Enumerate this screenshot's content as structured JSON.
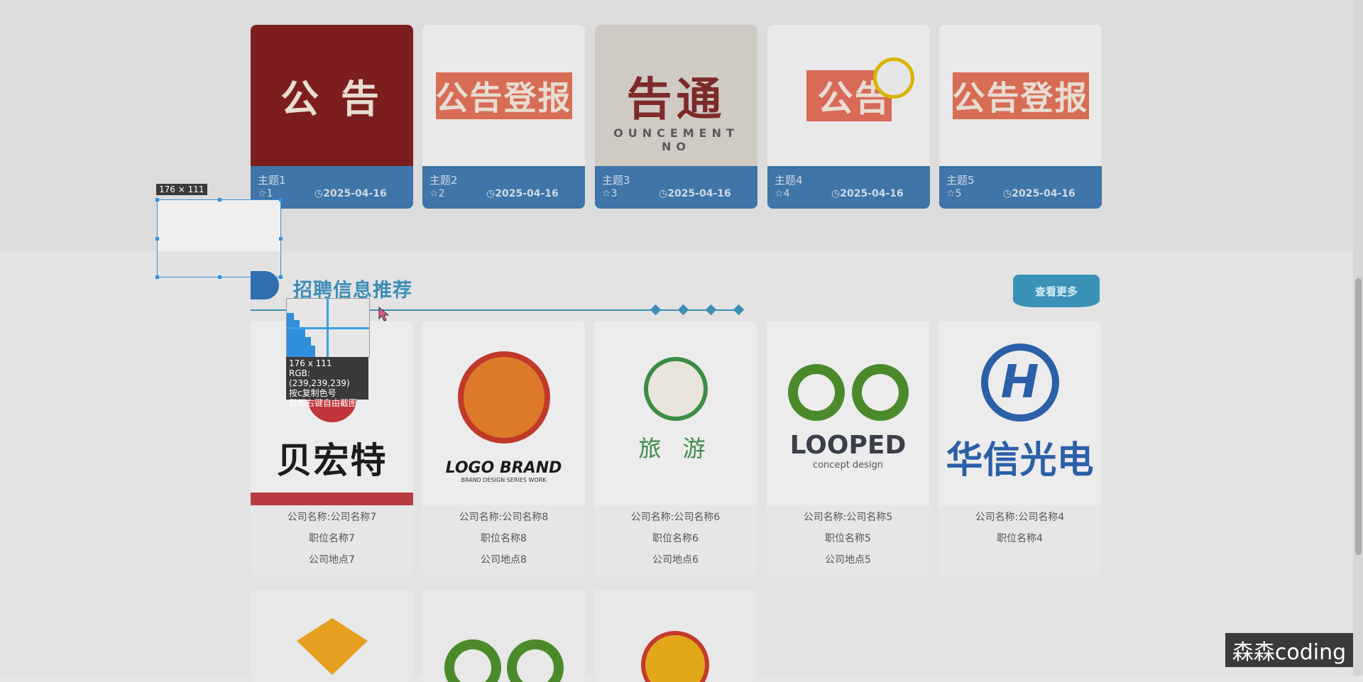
{
  "topics": [
    {
      "title": "主题1",
      "stars": "1",
      "date": "2025-04-16",
      "image_text": "公 告"
    },
    {
      "title": "主题2",
      "stars": "2",
      "date": "2025-04-16",
      "image_text": "公告登报"
    },
    {
      "title": "主题3",
      "stars": "3",
      "date": "2025-04-16",
      "image_text": "告通",
      "image_subtext": "OUNCEMENT NO"
    },
    {
      "title": "主题4",
      "stars": "4",
      "date": "2025-04-16",
      "image_text": "公告"
    },
    {
      "title": "主题5",
      "stars": "5",
      "date": "2025-04-16",
      "image_text": "公告登报"
    }
  ],
  "capture_tool": {
    "size_label": "176 × 111",
    "info_size": "176 x 111",
    "info_rgb": "RGB:(239,239,239)",
    "info_copy": "按c复制色号",
    "info_free": "鼠标右键自由截图"
  },
  "section": {
    "title": "招聘信息推荐",
    "more_label": "查看更多"
  },
  "jobs": [
    {
      "logo_text": "贝宏特",
      "company": "公司名称:公司名称7",
      "position": "职位名称7",
      "location": "公司地点7"
    },
    {
      "logo_text": "LOGO BRAND",
      "logo_sub": "BRAND DESIGN SERIES WORK",
      "company": "公司名称:公司名称8",
      "position": "职位名称8",
      "location": "公司地点8"
    },
    {
      "logo_text": "旅 游",
      "company": "公司名称:公司名称6",
      "position": "职位名称6",
      "location": "公司地点6"
    },
    {
      "logo_text": "LOOPED",
      "logo_sub": "concept design",
      "company": "公司名称:公司名称5",
      "position": "职位名称5",
      "location": "公司地点5"
    },
    {
      "logo_text": "华信光电",
      "company": "公司名称:公司名称4",
      "position": "职位名称4",
      "location": ""
    }
  ],
  "watermark": "森森coding"
}
